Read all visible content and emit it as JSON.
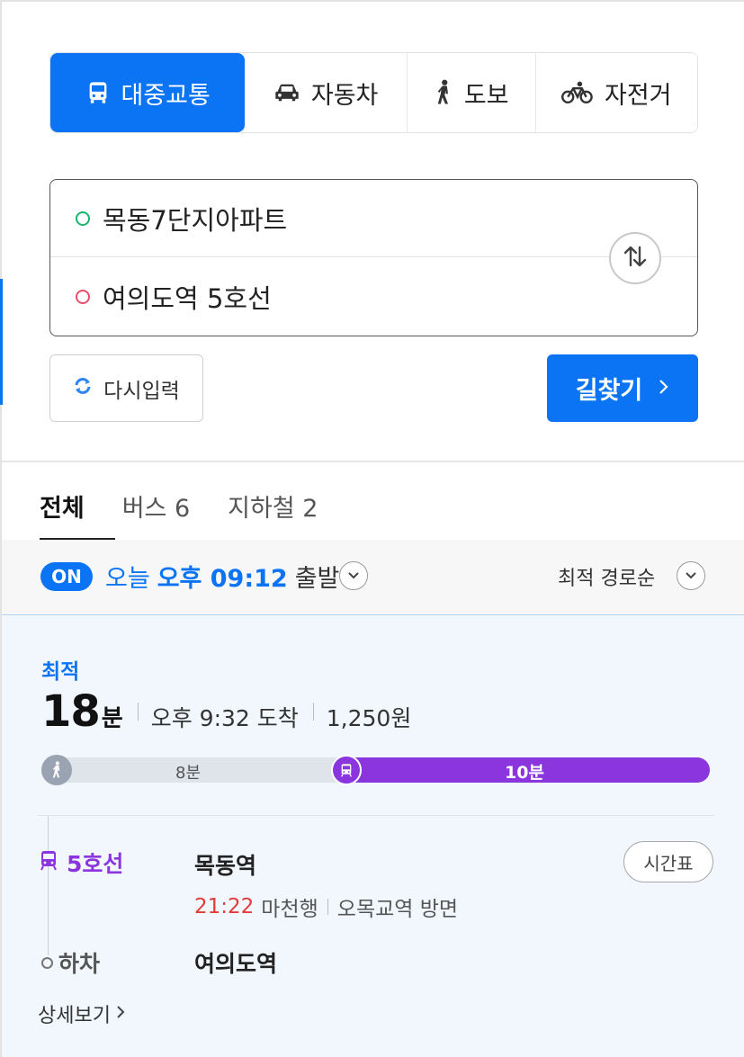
{
  "mode_tabs": [
    {
      "label": "대중교통",
      "icon": "bus-icon",
      "active": true
    },
    {
      "label": "자동차",
      "icon": "car-icon",
      "active": false
    },
    {
      "label": "도보",
      "icon": "walk-icon",
      "active": false
    },
    {
      "label": "자전거",
      "icon": "bicycle-icon",
      "active": false
    }
  ],
  "locations": {
    "origin": "목동7단지아파트",
    "destination": "여의도역 5호선"
  },
  "actions": {
    "reset_label": "다시입력",
    "search_label": "길찾기"
  },
  "result_tabs": [
    {
      "label": "전체",
      "active": true
    },
    {
      "label": "버스 6",
      "active": false
    },
    {
      "label": "지하철 2",
      "active": false
    }
  ],
  "departure": {
    "toggle": "ON",
    "day": "오늘",
    "time": "오후 09:12",
    "suffix": "출발",
    "sort_label": "최적 경로순"
  },
  "route": {
    "badge": "최적",
    "duration_num": "18",
    "duration_unit": "분",
    "arrival": "오후 9:32 도착",
    "fare": "1,250원",
    "segments": {
      "walk_label": "8분",
      "subway_label": "10분",
      "walk_minutes": 8,
      "subway_minutes": 10
    },
    "line_name": "5호선",
    "board_station": "목동역",
    "arrival_time": "21:22",
    "train_dest": "마천행",
    "direction": "오목교역 방면",
    "timetable_label": "시간표",
    "alight_label": "하차",
    "alight_station": "여의도역",
    "detail_label": "상세보기"
  },
  "colors": {
    "accent": "#0a74f5",
    "subway_line5": "#8a35de",
    "walk_segment": "#9aa3b2",
    "arrival_time": "#e23b3b",
    "origin_dot": "#1ab36b",
    "destination_dot": "#e94d6a"
  }
}
